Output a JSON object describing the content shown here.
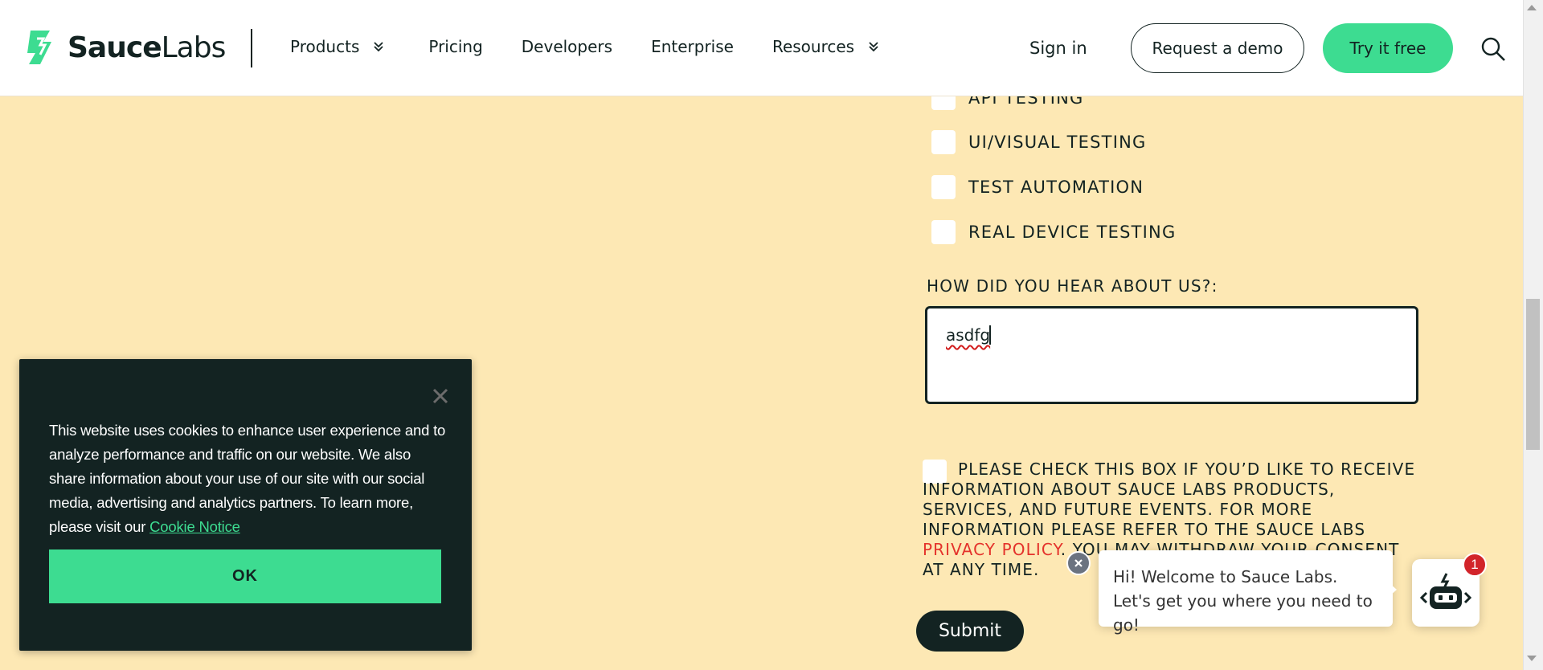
{
  "header": {
    "logo": {
      "bold": "Sauce",
      "light": "Labs",
      "icon": "saucelabs-logo-icon"
    },
    "nav": [
      {
        "label": "Products",
        "has_dropdown": true
      },
      {
        "label": "Pricing",
        "has_dropdown": false
      },
      {
        "label": "Developers",
        "has_dropdown": false
      },
      {
        "label": "Enterprise",
        "has_dropdown": false
      },
      {
        "label": "Resources",
        "has_dropdown": true
      }
    ],
    "sign_in": "Sign in",
    "request_demo": "Request a demo",
    "try_free": "Try it free",
    "search_icon": "search-icon"
  },
  "form": {
    "checkbox_options": [
      {
        "label": "API TESTING",
        "checked": false
      },
      {
        "label": "UI/VISUAL TESTING",
        "checked": false
      },
      {
        "label": "TEST AUTOMATION",
        "checked": false
      },
      {
        "label": "REAL DEVICE TESTING",
        "checked": false
      }
    ],
    "hear_about_label": "HOW DID YOU HEAR ABOUT US?:",
    "hear_about_value": "asdfg",
    "consent": {
      "text_before": "PLEASE CHECK THIS BOX IF YOU’D LIKE TO RECEIVE INFORMATION ABOUT SAUCE LABS PRODUCTS, SERVICES, AND FUTURE EVENTS. FOR MORE INFORMATION PLEASE REFER TO THE SAUCE LABS ",
      "link_text": "PRIVACY POLICY",
      "text_after": ". YOU MAY WITHDRAW YOUR CONSENT AT ANY TIME.",
      "checked": false
    },
    "submit_label": "Submit"
  },
  "cookie_banner": {
    "text": "This website uses cookies to enhance user experience and to analyze performance and traffic on our website. We also share information about your use of our site with our social media, advertising and analytics partners. To learn more, please visit our ",
    "link_text": "Cookie Notice",
    "ok_label": "OK"
  },
  "chat": {
    "message": "Hi! Welcome to Sauce Labs. Let's get you where you need to go!",
    "badge_count": "1",
    "launcher_icon": "robot-icon"
  },
  "colors": {
    "brand_green": "#3ddc91",
    "dark": "#132322",
    "page_bg": "#fde8b4",
    "link_red": "#e4322b",
    "badge_red": "#d2242a"
  }
}
